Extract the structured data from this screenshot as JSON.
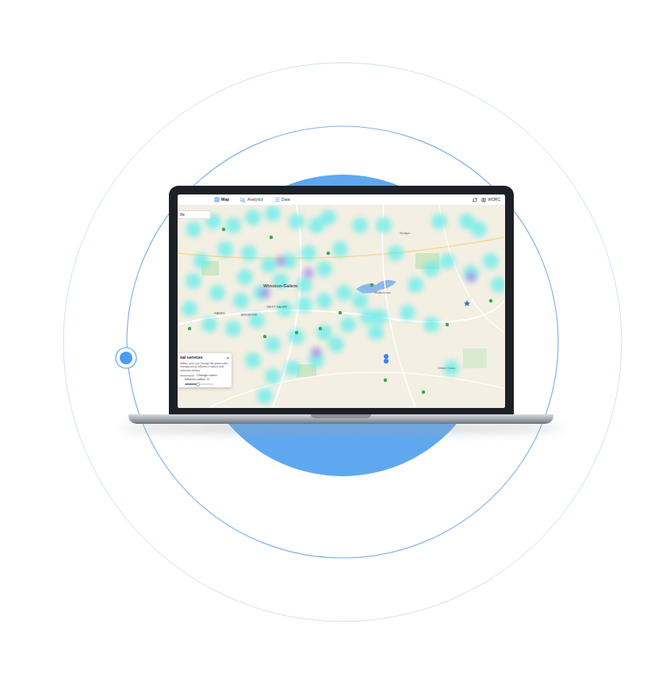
{
  "nav": {
    "tabs": [
      {
        "label": "Map",
        "selected": true
      },
      {
        "label": "Analytics",
        "selected": false
      },
      {
        "label": "Data",
        "selected": false
      }
    ],
    "account": "WORC"
  },
  "search": {
    "value": "ille"
  },
  "map_labels": [
    "Winston-Salem",
    "HANES",
    "ARDMORE",
    "WEST SALEM",
    "Walkertown",
    "Union Cross",
    "Gudger"
  ],
  "panel": {
    "title": "nal services",
    "close": "×",
    "description": "tables, you can change the point color, transparency, influence radius and selectors below.",
    "button": "Change colors",
    "slider": {
      "label": "Influence radius:",
      "reading": "40",
      "level": 0.45
    }
  }
}
